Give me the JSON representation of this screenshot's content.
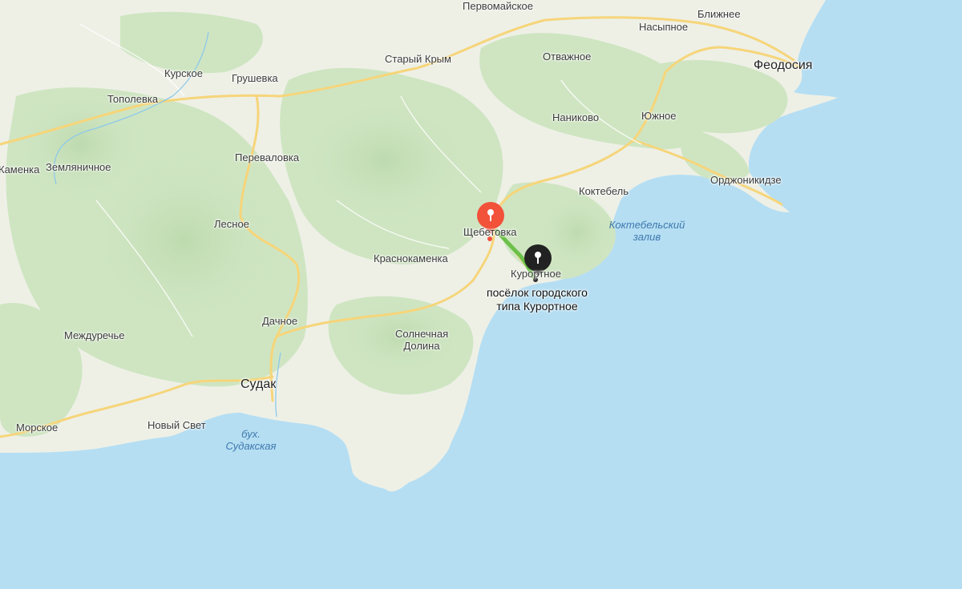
{
  "map": {
    "colors": {
      "sea": "#b5def3",
      "land": "#eef0e6",
      "forest": "#cfe5c2",
      "road": "#f6d57a",
      "route": "#6cc04a",
      "start_pin": "#f2513a",
      "end_pin": "#222222",
      "water_text": "#3f79ad"
    },
    "places": {
      "pervomayskoe": "Первомайское",
      "blizhnee": "Ближнее",
      "nasypnoe": "Насыпное",
      "staryy_krym": "Старый Крым",
      "otvazhnoe": "Отважное",
      "feodosiya": "Феодосия",
      "kurskoe": "Курское",
      "grushevka": "Грушевка",
      "topolevka": "Тополевка",
      "nanikovo": "Наниково",
      "yuzhnoe": "Южное",
      "perevalovka": "Перевал​овка",
      "kamenka_partial": "Каменка",
      "zemlyanichnoe": "Земляничное",
      "ordzhonikidze": "Орджоникидзе",
      "koktebel": "Коктебель",
      "lesnoe": "Лесное",
      "shchebetovka": "Щебетовка",
      "krasnokamenka": "Краснокаменка",
      "kurortnoe": "Курортное",
      "dachnoe": "Дачное",
      "mezhdurechye": "Междуречье",
      "solnechnaya_dolina_1": "Солнечная",
      "solnechnaya_dolina_2": "Долина",
      "sudak": "Судак",
      "morskoe": "Морское",
      "novyy_svet": "Новый Свет"
    },
    "water": {
      "koktebel_bay_1": "Коктебельский",
      "koktebel_bay_2": "залив",
      "sudak_bay_1": "бух.",
      "sudak_bay_2": "Судакская"
    },
    "destination": {
      "line1": "посёлок городского",
      "line2": "типа Курортное"
    },
    "icons": {
      "start": "map-pin-icon",
      "end": "map-pin-icon"
    }
  }
}
